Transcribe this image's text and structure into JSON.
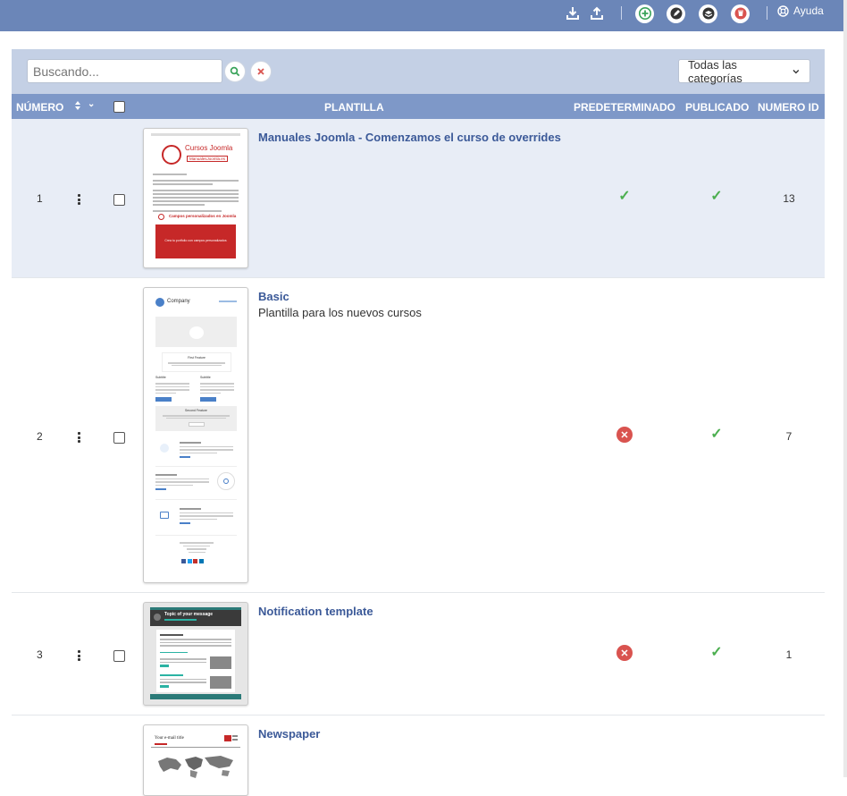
{
  "toolbar": {
    "icons": [
      "download-icon",
      "upload-icon",
      "add-icon",
      "edit-icon",
      "layers-icon",
      "trash-icon",
      "help-icon"
    ],
    "help_label": "Ayuda"
  },
  "filters": {
    "search_placeholder": "Buscando...",
    "category_selected": "Todas las categorías"
  },
  "table": {
    "headers": {
      "number": "NÚMERO",
      "template": "PLANTILLA",
      "default": "PREDETERMINADO",
      "published": "PUBLICADO",
      "id": "NUMERO ID"
    },
    "rows": [
      {
        "number": "1",
        "title": "Manuales Joomla - Comenzamos el curso de overrides",
        "description": "",
        "is_default": true,
        "is_published": true,
        "id": "13",
        "thumb": {
          "brand": "Cursos Joomla",
          "brand_sub": "ManualesJoomla.es",
          "heading": "Campos personalizados en Joomla",
          "cta": "Crea tu portfolio con campos personalizados"
        }
      },
      {
        "number": "2",
        "title": "Basic",
        "description": "Plantilla para los nuevos cursos",
        "is_default": false,
        "is_published": true,
        "id": "7",
        "thumb": {
          "brand": "Company",
          "feature1": "First Feature",
          "feature2": "Second Feature",
          "subtitle": "Subtitle"
        }
      },
      {
        "number": "3",
        "title": "Notification template",
        "description": "",
        "is_default": false,
        "is_published": true,
        "id": "1",
        "thumb": {
          "heading": "Topic of your message"
        }
      },
      {
        "number": "",
        "title": "Newspaper",
        "description": "",
        "thumb": {
          "heading": "Your e-mail title"
        }
      }
    ]
  },
  "colors": {
    "topbar": "#6b86b8",
    "filterbar": "#c4d0e5",
    "header": "#7e98c8",
    "selected_row": "#e8edf6",
    "title_link": "#3b5998",
    "ok": "#4caf50",
    "error": "#d9534f"
  }
}
